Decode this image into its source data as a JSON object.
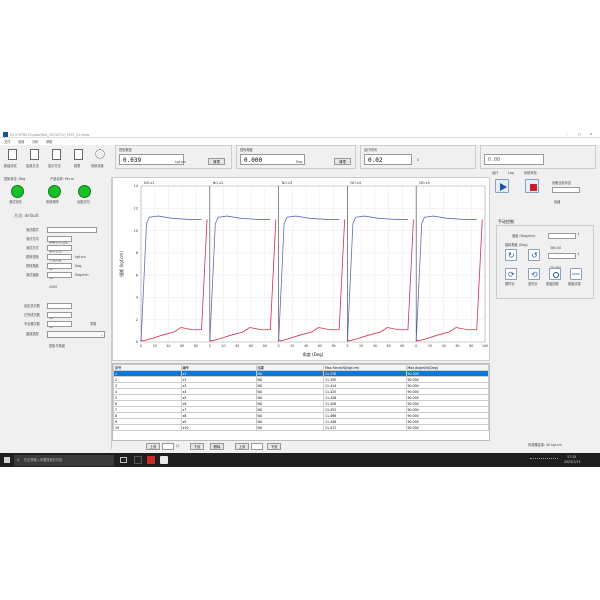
{
  "window": {
    "title": "V3.0  MTBS  D:\\data\\Test_20230712_TEST_01.mtbs",
    "menus": [
      "文件",
      "设置",
      "分析",
      "帮助"
    ]
  },
  "toolbar": {
    "buttons": [
      "新建测试",
      "加载方法",
      "显示方法",
      "报表",
      "系统设置"
    ]
  },
  "readouts": {
    "torque": {
      "label": "扭矩数值",
      "value": "0.039",
      "unit": "kgf.cm",
      "button": "清零"
    },
    "angle": {
      "label": "扭转角度",
      "value": "0.000",
      "unit": "Deg",
      "button": "清零"
    },
    "time": {
      "label": "运行时间",
      "value": "0.02",
      "unit": "S"
    },
    "extra": {
      "label": "",
      "value": "0.00"
    }
  },
  "status": {
    "labels": [
      "扭矩单位: Deg",
      "产品名称: Per-m"
    ],
    "leds": [
      {
        "label": "测试状态",
        "color": "#19c02a"
      },
      {
        "label": "系统故障",
        "color": "#19c02a"
      },
      {
        "label": "功能方向",
        "color": "#19c02a"
      }
    ],
    "method": "方法:  default"
  },
  "form": {
    "fields": [
      {
        "label": "测试模式",
        "value": "屏幕有效扭矩"
      },
      {
        "label": "测试方向",
        "value": "顺时针扭"
      },
      {
        "label": "测试方式",
        "value": "下限判定"
      },
      {
        "label": "扭转扭矩",
        "value": "10",
        "unit": "kgf.cm"
      },
      {
        "label": "扭转角度",
        "value": "90",
        "unit": "Deg"
      },
      {
        "label": "测试速度",
        "value": "2000",
        "unit": "Deg/min"
      }
    ],
    "counters": [
      {
        "label": "设定总次数",
        "value": "10"
      },
      {
        "label": "已完成次数",
        "value": "10"
      },
      {
        "label": "不合格次数",
        "value": "0",
        "button": "重置"
      }
    ],
    "curve_type": {
      "label": "曲线类型",
      "value": "扭矩与角度"
    }
  },
  "chart_data": {
    "type": "line",
    "panels": [
      "NO.x1",
      "NO.x2",
      "NO.x3",
      "NO.x4",
      "NO.x5"
    ],
    "xlabel": "角度 (Deg)",
    "ylabel": "扭矩 (kgf.cm)",
    "ylim": [
      0,
      14
    ],
    "yticks": [
      "0",
      "2",
      "4",
      "6",
      "8",
      "10",
      "12",
      "14"
    ],
    "x_ticks": [
      "0",
      "20",
      "40",
      "60",
      "80",
      "0",
      "20",
      "40",
      "60",
      "80",
      "0",
      "20",
      "40",
      "60",
      "80",
      "0",
      "20",
      "40",
      "60",
      "80",
      "0",
      "20",
      "40",
      "60",
      "80",
      "100"
    ],
    "series": [
      {
        "color": "#5a6fb6",
        "x": [
          0,
          8,
          12,
          25,
          45,
          70,
          88
        ],
        "y": [
          0,
          10.6,
          11.2,
          11.3,
          11.1,
          11.0,
          11.0
        ]
      },
      {
        "color": "#d0304e",
        "x": [
          0,
          3,
          15,
          30,
          48,
          58,
          75,
          88,
          96
        ],
        "y": [
          0.2,
          0.1,
          0.3,
          0.6,
          0.9,
          1.3,
          1.1,
          1.1,
          11.0
        ]
      }
    ],
    "grid": true
  },
  "table": {
    "headers": [
      "序号",
      "编号",
      "结果",
      "Max Force(N)(kgf.cm)",
      "Max Angle(N)(Deg)"
    ],
    "rows": [
      [
        "1",
        "x1",
        "NG",
        "11.376",
        "90.000"
      ],
      [
        "2",
        "x2",
        "NG",
        "11.350",
        "90.000"
      ],
      [
        "3",
        "x3",
        "NG",
        "11.414",
        "90.000"
      ],
      [
        "4",
        "x4",
        "NG",
        "11.420",
        "90.000"
      ],
      [
        "5",
        "x5",
        "NG",
        "11.438",
        "90.000"
      ],
      [
        "6",
        "x6",
        "NG",
        "11.428",
        "90.000"
      ],
      [
        "7",
        "x7",
        "NG",
        "11.452",
        "90.000"
      ],
      [
        "8",
        "x8",
        "NG",
        "11.466",
        "90.000"
      ],
      [
        "9",
        "x9",
        "NG",
        "11.446",
        "90.000"
      ],
      [
        "10",
        "x10",
        "NG",
        "11.472",
        "90.000"
      ]
    ],
    "selected_row": 0
  },
  "pager": {
    "left": {
      "prev": "上页",
      "page": "1",
      "of": "/1",
      "next": "下页",
      "delete": "删除"
    },
    "right": {
      "prev": "上页",
      "page": "1",
      "next": "下页"
    }
  },
  "control": {
    "tabs": [
      "运行",
      "Log",
      "系统状态"
    ],
    "device_status_label": "设备当前状态",
    "device_status_value": "就绪",
    "manual_title": "手动控制",
    "speed_label": "速度 (Deg/min)",
    "speed_value": "360.00",
    "angle_label": "旋转角度 (Deg)",
    "angle_value": "25.000",
    "action_labels": [
      "顺时针",
      "逆时针",
      "角度回零",
      "角度清零"
    ]
  },
  "footer": {
    "sensor": "传感器容量: 40 kgf.cm"
  },
  "taskbar": {
    "search_placeholder": "在这里输入你要搜索的内容",
    "time": "17:15",
    "date": "2023/7/13"
  }
}
